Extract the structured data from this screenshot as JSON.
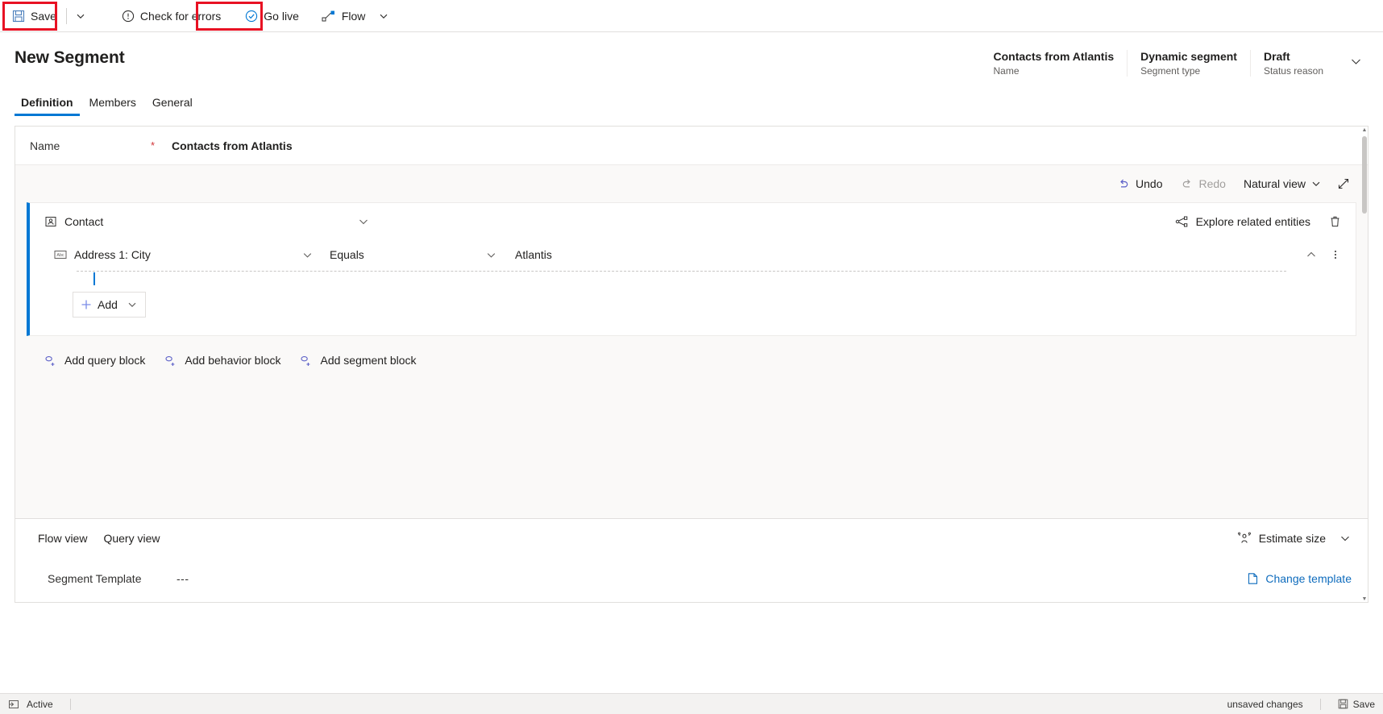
{
  "commandbar": {
    "save_label": "Save",
    "check_errors_label": "Check for errors",
    "go_live_label": "Go live",
    "flow_label": "Flow"
  },
  "header": {
    "title": "New Segment",
    "fields": [
      {
        "value": "Contacts from Atlantis",
        "label": "Name"
      },
      {
        "value": "Dynamic segment",
        "label": "Segment type"
      },
      {
        "value": "Draft",
        "label": "Status reason"
      }
    ]
  },
  "tabs": [
    {
      "label": "Definition",
      "active": true
    },
    {
      "label": "Members",
      "active": false
    },
    {
      "label": "General",
      "active": false
    }
  ],
  "form": {
    "name_label": "Name",
    "required_marker": "*",
    "name_value": "Contacts from Atlantis"
  },
  "builder_toolbar": {
    "undo_label": "Undo",
    "redo_label": "Redo",
    "view_label": "Natural view"
  },
  "query_block": {
    "entity": "Contact",
    "explore_label": "Explore related entities",
    "condition": {
      "attribute": "Address 1: City",
      "operator": "Equals",
      "value": "Atlantis"
    },
    "add_label": "Add"
  },
  "block_actions": [
    {
      "label": "Add query block"
    },
    {
      "label": "Add behavior block"
    },
    {
      "label": "Add segment block"
    }
  ],
  "footer": {
    "flow_view_label": "Flow view",
    "query_view_label": "Query view",
    "estimate_label": "Estimate size",
    "template_label": "Segment Template",
    "template_value": "---",
    "change_template_label": "Change template"
  },
  "statusbar": {
    "status_label": "Active",
    "unsaved_label": "unsaved changes",
    "save_label": "Save"
  },
  "colors": {
    "accent": "#0078d4",
    "link": "#0f6cbd",
    "highlight_box": "#e81123",
    "required": "#d13438"
  }
}
